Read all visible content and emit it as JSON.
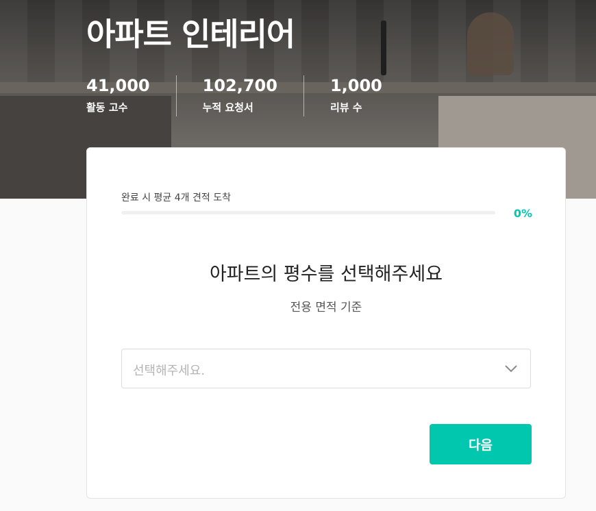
{
  "hero": {
    "title": "아파트 인테리어",
    "stats": [
      {
        "value": "41,000",
        "label": "활동 고수"
      },
      {
        "value": "102,700",
        "label": "누적 요청서"
      },
      {
        "value": "1,000",
        "label": "리뷰 수"
      }
    ]
  },
  "card": {
    "progress_label": "완료 시 평균 4개 견적 도착",
    "progress_percent": "0%",
    "progress_value": 0,
    "question_title": "아파트의 평수를 선택해주세요",
    "question_subtitle": "전용 면적 기준",
    "select_placeholder": "선택해주세요.",
    "next_button": "다음"
  },
  "colors": {
    "accent": "#00c7ae",
    "title_text": "#ffffff"
  }
}
